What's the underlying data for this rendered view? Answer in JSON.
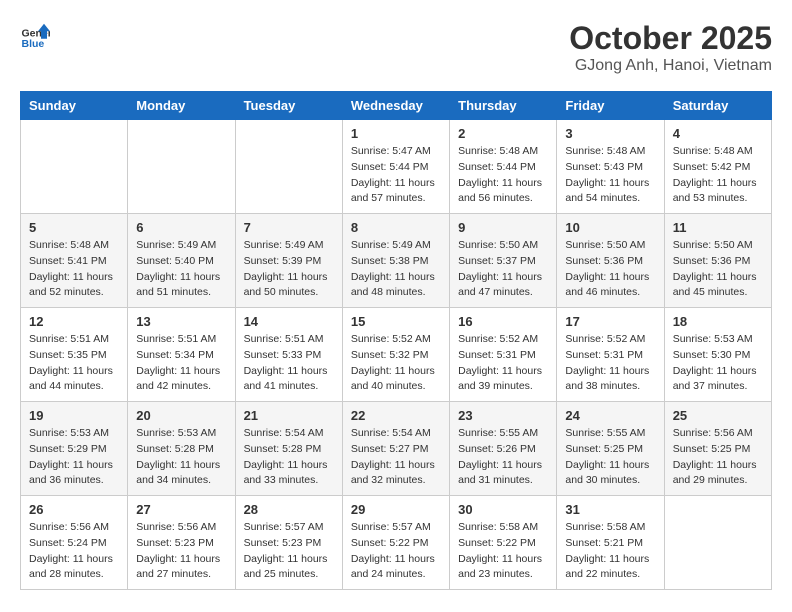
{
  "header": {
    "logo_general": "General",
    "logo_blue": "Blue",
    "title": "October 2025",
    "subtitle": "GJong Anh, Hanoi, Vietnam"
  },
  "weekdays": [
    "Sunday",
    "Monday",
    "Tuesday",
    "Wednesday",
    "Thursday",
    "Friday",
    "Saturday"
  ],
  "weeks": [
    [
      {
        "day": "",
        "info": ""
      },
      {
        "day": "",
        "info": ""
      },
      {
        "day": "",
        "info": ""
      },
      {
        "day": "1",
        "info": "Sunrise: 5:47 AM\nSunset: 5:44 PM\nDaylight: 11 hours\nand 57 minutes."
      },
      {
        "day": "2",
        "info": "Sunrise: 5:48 AM\nSunset: 5:44 PM\nDaylight: 11 hours\nand 56 minutes."
      },
      {
        "day": "3",
        "info": "Sunrise: 5:48 AM\nSunset: 5:43 PM\nDaylight: 11 hours\nand 54 minutes."
      },
      {
        "day": "4",
        "info": "Sunrise: 5:48 AM\nSunset: 5:42 PM\nDaylight: 11 hours\nand 53 minutes."
      }
    ],
    [
      {
        "day": "5",
        "info": "Sunrise: 5:48 AM\nSunset: 5:41 PM\nDaylight: 11 hours\nand 52 minutes."
      },
      {
        "day": "6",
        "info": "Sunrise: 5:49 AM\nSunset: 5:40 PM\nDaylight: 11 hours\nand 51 minutes."
      },
      {
        "day": "7",
        "info": "Sunrise: 5:49 AM\nSunset: 5:39 PM\nDaylight: 11 hours\nand 50 minutes."
      },
      {
        "day": "8",
        "info": "Sunrise: 5:49 AM\nSunset: 5:38 PM\nDaylight: 11 hours\nand 48 minutes."
      },
      {
        "day": "9",
        "info": "Sunrise: 5:50 AM\nSunset: 5:37 PM\nDaylight: 11 hours\nand 47 minutes."
      },
      {
        "day": "10",
        "info": "Sunrise: 5:50 AM\nSunset: 5:36 PM\nDaylight: 11 hours\nand 46 minutes."
      },
      {
        "day": "11",
        "info": "Sunrise: 5:50 AM\nSunset: 5:36 PM\nDaylight: 11 hours\nand 45 minutes."
      }
    ],
    [
      {
        "day": "12",
        "info": "Sunrise: 5:51 AM\nSunset: 5:35 PM\nDaylight: 11 hours\nand 44 minutes."
      },
      {
        "day": "13",
        "info": "Sunrise: 5:51 AM\nSunset: 5:34 PM\nDaylight: 11 hours\nand 42 minutes."
      },
      {
        "day": "14",
        "info": "Sunrise: 5:51 AM\nSunset: 5:33 PM\nDaylight: 11 hours\nand 41 minutes."
      },
      {
        "day": "15",
        "info": "Sunrise: 5:52 AM\nSunset: 5:32 PM\nDaylight: 11 hours\nand 40 minutes."
      },
      {
        "day": "16",
        "info": "Sunrise: 5:52 AM\nSunset: 5:31 PM\nDaylight: 11 hours\nand 39 minutes."
      },
      {
        "day": "17",
        "info": "Sunrise: 5:52 AM\nSunset: 5:31 PM\nDaylight: 11 hours\nand 38 minutes."
      },
      {
        "day": "18",
        "info": "Sunrise: 5:53 AM\nSunset: 5:30 PM\nDaylight: 11 hours\nand 37 minutes."
      }
    ],
    [
      {
        "day": "19",
        "info": "Sunrise: 5:53 AM\nSunset: 5:29 PM\nDaylight: 11 hours\nand 36 minutes."
      },
      {
        "day": "20",
        "info": "Sunrise: 5:53 AM\nSunset: 5:28 PM\nDaylight: 11 hours\nand 34 minutes."
      },
      {
        "day": "21",
        "info": "Sunrise: 5:54 AM\nSunset: 5:28 PM\nDaylight: 11 hours\nand 33 minutes."
      },
      {
        "day": "22",
        "info": "Sunrise: 5:54 AM\nSunset: 5:27 PM\nDaylight: 11 hours\nand 32 minutes."
      },
      {
        "day": "23",
        "info": "Sunrise: 5:55 AM\nSunset: 5:26 PM\nDaylight: 11 hours\nand 31 minutes."
      },
      {
        "day": "24",
        "info": "Sunrise: 5:55 AM\nSunset: 5:25 PM\nDaylight: 11 hours\nand 30 minutes."
      },
      {
        "day": "25",
        "info": "Sunrise: 5:56 AM\nSunset: 5:25 PM\nDaylight: 11 hours\nand 29 minutes."
      }
    ],
    [
      {
        "day": "26",
        "info": "Sunrise: 5:56 AM\nSunset: 5:24 PM\nDaylight: 11 hours\nand 28 minutes."
      },
      {
        "day": "27",
        "info": "Sunrise: 5:56 AM\nSunset: 5:23 PM\nDaylight: 11 hours\nand 27 minutes."
      },
      {
        "day": "28",
        "info": "Sunrise: 5:57 AM\nSunset: 5:23 PM\nDaylight: 11 hours\nand 25 minutes."
      },
      {
        "day": "29",
        "info": "Sunrise: 5:57 AM\nSunset: 5:22 PM\nDaylight: 11 hours\nand 24 minutes."
      },
      {
        "day": "30",
        "info": "Sunrise: 5:58 AM\nSunset: 5:22 PM\nDaylight: 11 hours\nand 23 minutes."
      },
      {
        "day": "31",
        "info": "Sunrise: 5:58 AM\nSunset: 5:21 PM\nDaylight: 11 hours\nand 22 minutes."
      },
      {
        "day": "",
        "info": ""
      }
    ]
  ]
}
